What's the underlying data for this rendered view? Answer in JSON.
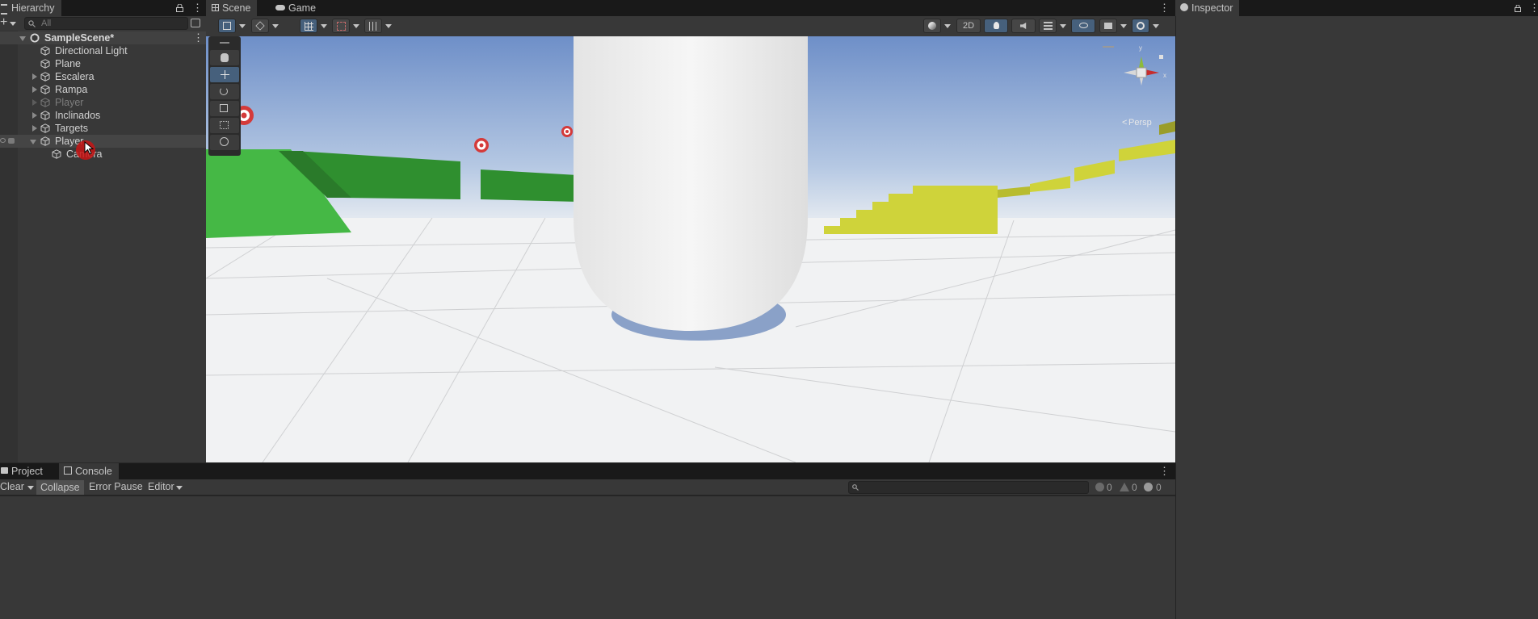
{
  "hierarchy": {
    "title": "Hierarchy",
    "search_placeholder": "All",
    "scene_name": "SampleScene*",
    "items": [
      {
        "label": "Directional Light"
      },
      {
        "label": "Plane"
      },
      {
        "label": "Escalera"
      },
      {
        "label": "Rampa"
      },
      {
        "label": "Player"
      },
      {
        "label": "Inclinados"
      },
      {
        "label": "Targets"
      },
      {
        "label": "Player"
      },
      {
        "label": "Camera"
      }
    ]
  },
  "scene_tabs": {
    "scene": "Scene",
    "game": "Game"
  },
  "scene_toolbar": {
    "mode_2d": "2D"
  },
  "scene_gizmo": {
    "axis_y": "y",
    "axis_x": "x",
    "persp": "Persp"
  },
  "inspector": {
    "title": "Inspector"
  },
  "bottom_tabs": {
    "project": "Project",
    "console": "Console"
  },
  "console": {
    "clear": "Clear",
    "collapse": "Collapse",
    "error_pause": "Error Pause",
    "editor": "Editor",
    "log_count": "0",
    "warning_count": "0",
    "error_count": "0"
  },
  "colors": {
    "accent": "#46607c",
    "panel": "#383838",
    "dark": "#191919",
    "grass": "#2f8f2f",
    "stairs": "#cfd33a"
  }
}
